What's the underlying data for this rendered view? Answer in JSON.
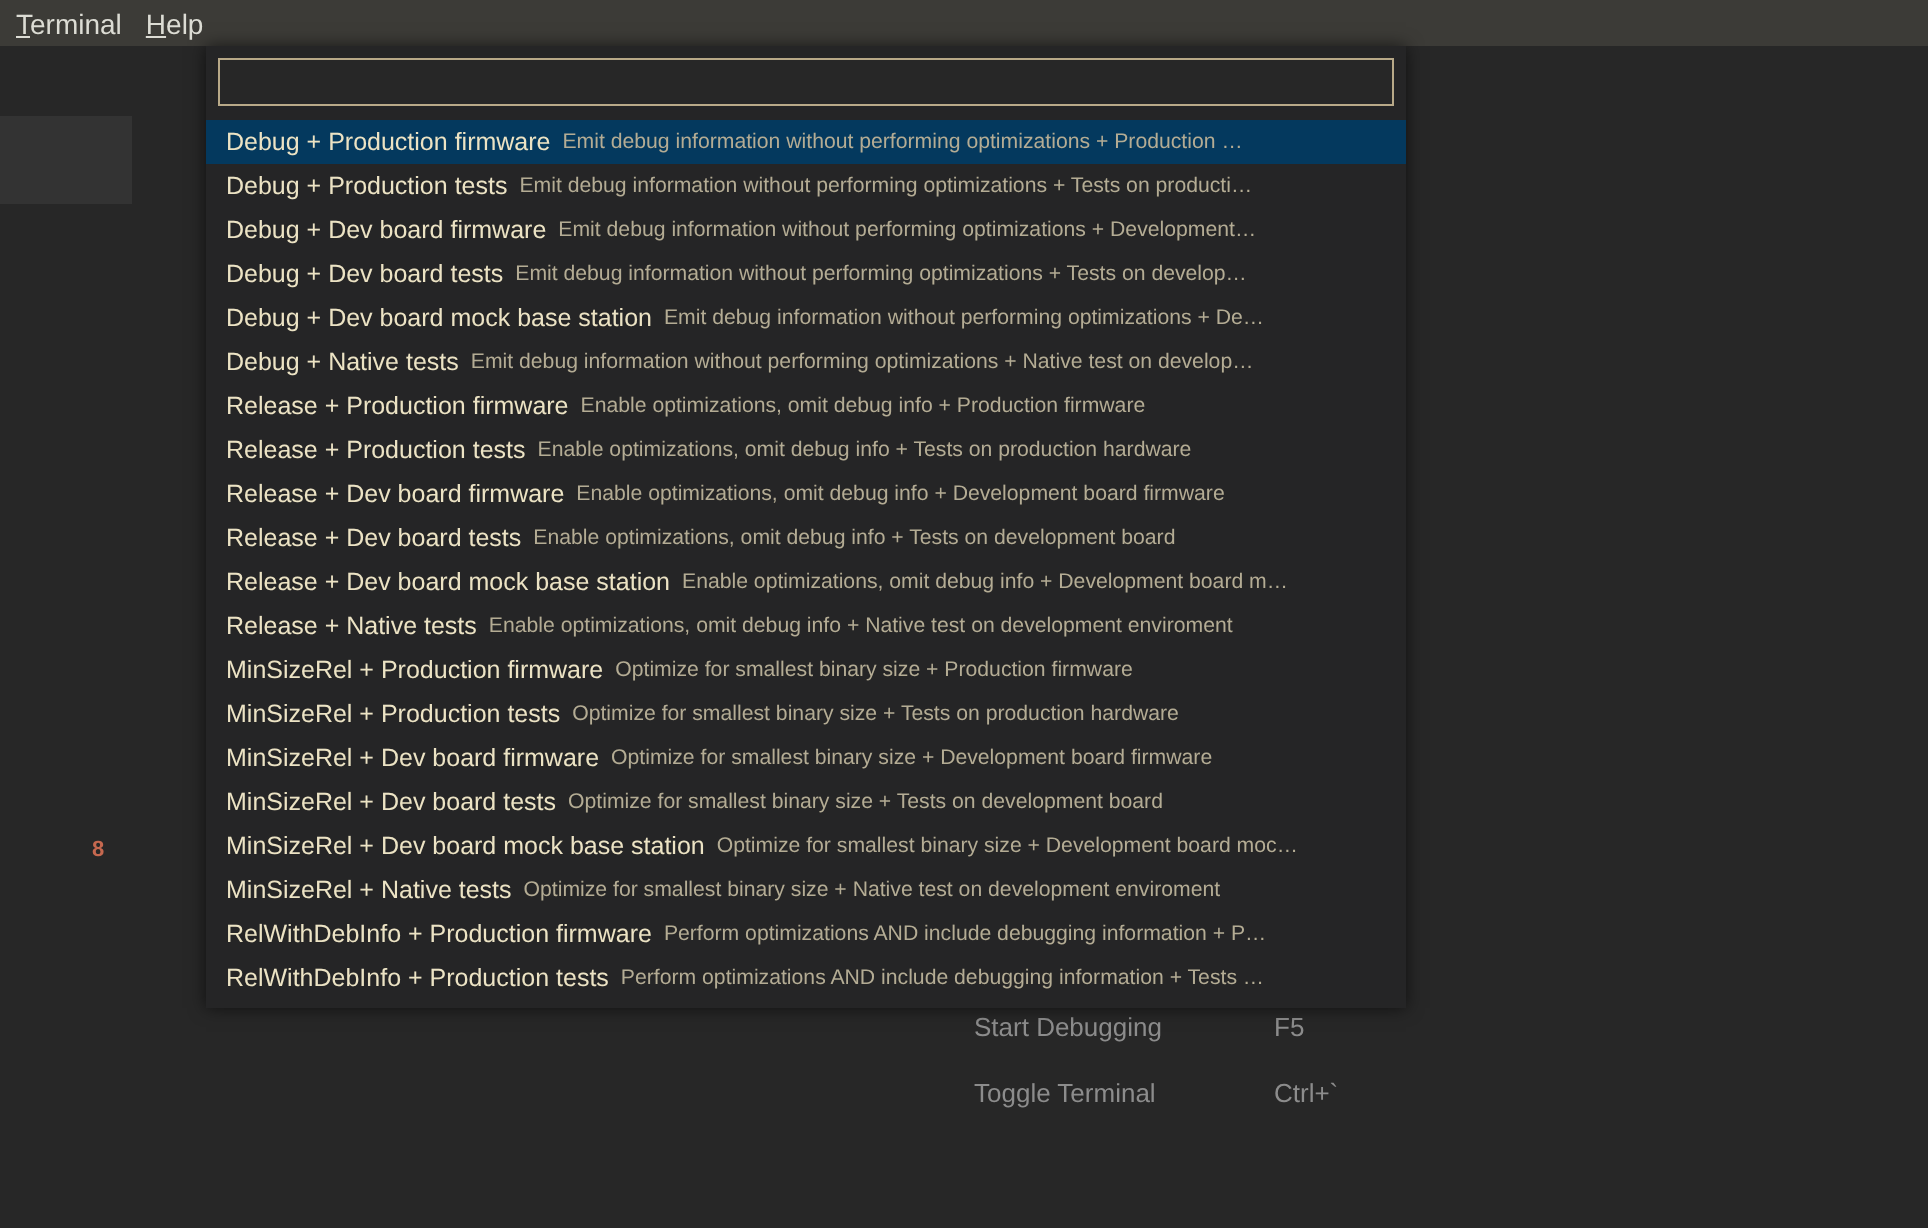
{
  "menu_bar": [
    {
      "label": "Terminal"
    },
    {
      "label": "Help"
    }
  ],
  "side_badge": "8",
  "shortcuts": [
    {
      "label": "Start Debugging",
      "keys": "F5"
    },
    {
      "label": "Toggle Terminal",
      "keys": "Ctrl+`"
    }
  ],
  "quick_pick": {
    "items": [
      {
        "label": "Debug + Production firmware",
        "description": "Emit debug information without performing optimizations + Production …",
        "selected": true
      },
      {
        "label": "Debug + Production tests",
        "description": "Emit debug information without performing optimizations + Tests on producti…",
        "selected": false
      },
      {
        "label": "Debug + Dev board firmware",
        "description": "Emit debug information without performing optimizations + Development…",
        "selected": false
      },
      {
        "label": "Debug + Dev board tests",
        "description": "Emit debug information without performing optimizations + Tests on develop…",
        "selected": false
      },
      {
        "label": "Debug + Dev board mock base station",
        "description": "Emit debug information without performing optimizations + De…",
        "selected": false
      },
      {
        "label": "Debug + Native tests",
        "description": "Emit debug information without performing optimizations + Native test on develop…",
        "selected": false
      },
      {
        "label": "Release + Production firmware",
        "description": "Enable optimizations, omit debug info + Production firmware",
        "selected": false
      },
      {
        "label": "Release + Production tests",
        "description": "Enable optimizations, omit debug info + Tests on production hardware",
        "selected": false
      },
      {
        "label": "Release + Dev board firmware",
        "description": "Enable optimizations, omit debug info + Development board firmware",
        "selected": false
      },
      {
        "label": "Release + Dev board tests",
        "description": "Enable optimizations, omit debug info + Tests on development board",
        "selected": false
      },
      {
        "label": "Release + Dev board mock base station",
        "description": "Enable optimizations, omit debug info + Development board m…",
        "selected": false
      },
      {
        "label": "Release + Native tests",
        "description": "Enable optimizations, omit debug info + Native test on development enviroment",
        "selected": false
      },
      {
        "label": "MinSizeRel + Production firmware",
        "description": "Optimize for smallest binary size + Production firmware",
        "selected": false
      },
      {
        "label": "MinSizeRel + Production tests",
        "description": "Optimize for smallest binary size + Tests on production hardware",
        "selected": false
      },
      {
        "label": "MinSizeRel + Dev board firmware",
        "description": "Optimize for smallest binary size + Development board firmware",
        "selected": false
      },
      {
        "label": "MinSizeRel + Dev board tests",
        "description": "Optimize for smallest binary size + Tests on development board",
        "selected": false
      },
      {
        "label": "MinSizeRel + Dev board mock base station",
        "description": "Optimize for smallest binary size + Development board moc…",
        "selected": false
      },
      {
        "label": "MinSizeRel + Native tests",
        "description": "Optimize for smallest binary size + Native test on development enviroment",
        "selected": false
      },
      {
        "label": "RelWithDebInfo + Production firmware",
        "description": "Perform optimizations AND include debugging information + P…",
        "selected": false
      },
      {
        "label": "RelWithDebInfo + Production tests",
        "description": "Perform optimizations AND include debugging information + Tests …",
        "selected": false
      }
    ]
  }
}
